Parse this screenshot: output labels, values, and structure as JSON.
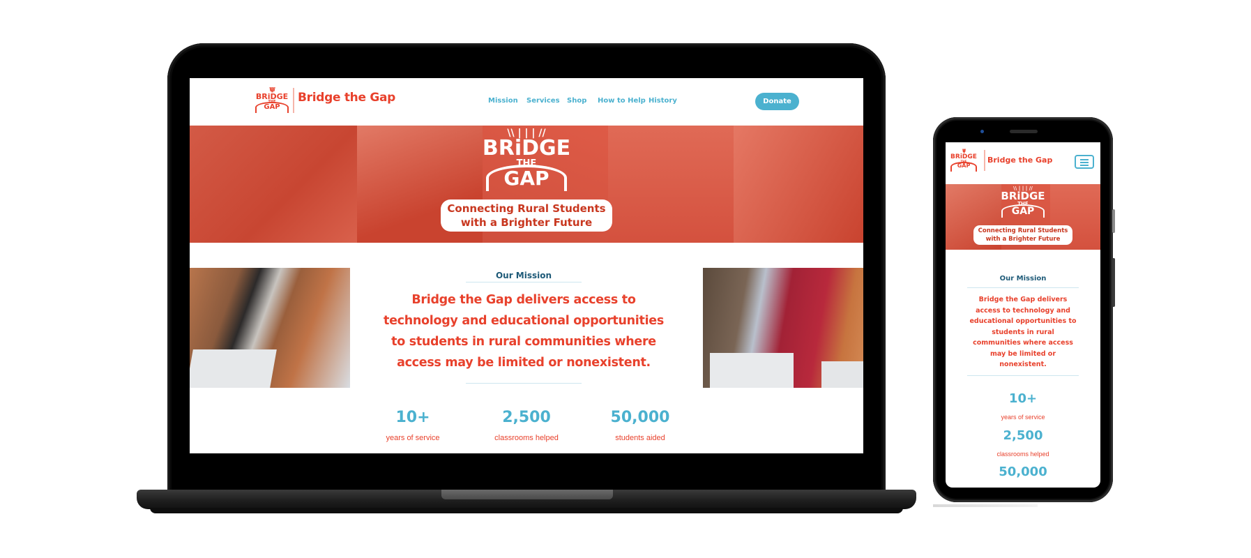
{
  "site": {
    "brand_name": "Bridge the Gap",
    "logo": {
      "line1": "BRiDGE",
      "line2": "THE",
      "line3": "GAP",
      "burst": "\\\\||//"
    },
    "nav": [
      {
        "label": "Mission"
      },
      {
        "label": "Services"
      },
      {
        "label": "Shop"
      },
      {
        "label": "How to Help"
      },
      {
        "label": "History"
      }
    ],
    "donate_label": "Donate",
    "menu_icon": "hamburger-menu-icon"
  },
  "hero": {
    "logo_line1": "BRiDGE",
    "logo_line2": "THE",
    "logo_line3": "GAP",
    "tagline_line1": "Connecting Rural Students",
    "tagline_line2": "with a Brighter Future"
  },
  "mission": {
    "title": "Our Mission",
    "text": "Bridge the Gap delivers access to technology and educational opportunities to students in rural communities where access may be limited or nonexistent.",
    "desktop_lines": [
      "Bridge the Gap delivers access to",
      "technology and educational opportunities",
      "to students in rural communities where",
      "access may be limited or nonexistent."
    ],
    "mobile_lines": [
      "Bridge the Gap delivers",
      "access to technology and",
      "educational opportunities to",
      "students in rural",
      "communities where access",
      "may be limited or",
      "nonexistent."
    ]
  },
  "stats": [
    {
      "value": "10+",
      "label": "years of service"
    },
    {
      "value": "2,500",
      "label": "classrooms helped"
    },
    {
      "value": "50,000",
      "label": "students aided"
    }
  ],
  "colors": {
    "brand_red": "#e8412c",
    "accent_blue": "#4bb1cf",
    "heading_navy": "#1e5a78",
    "hero_overlay": "#d94f3c"
  }
}
